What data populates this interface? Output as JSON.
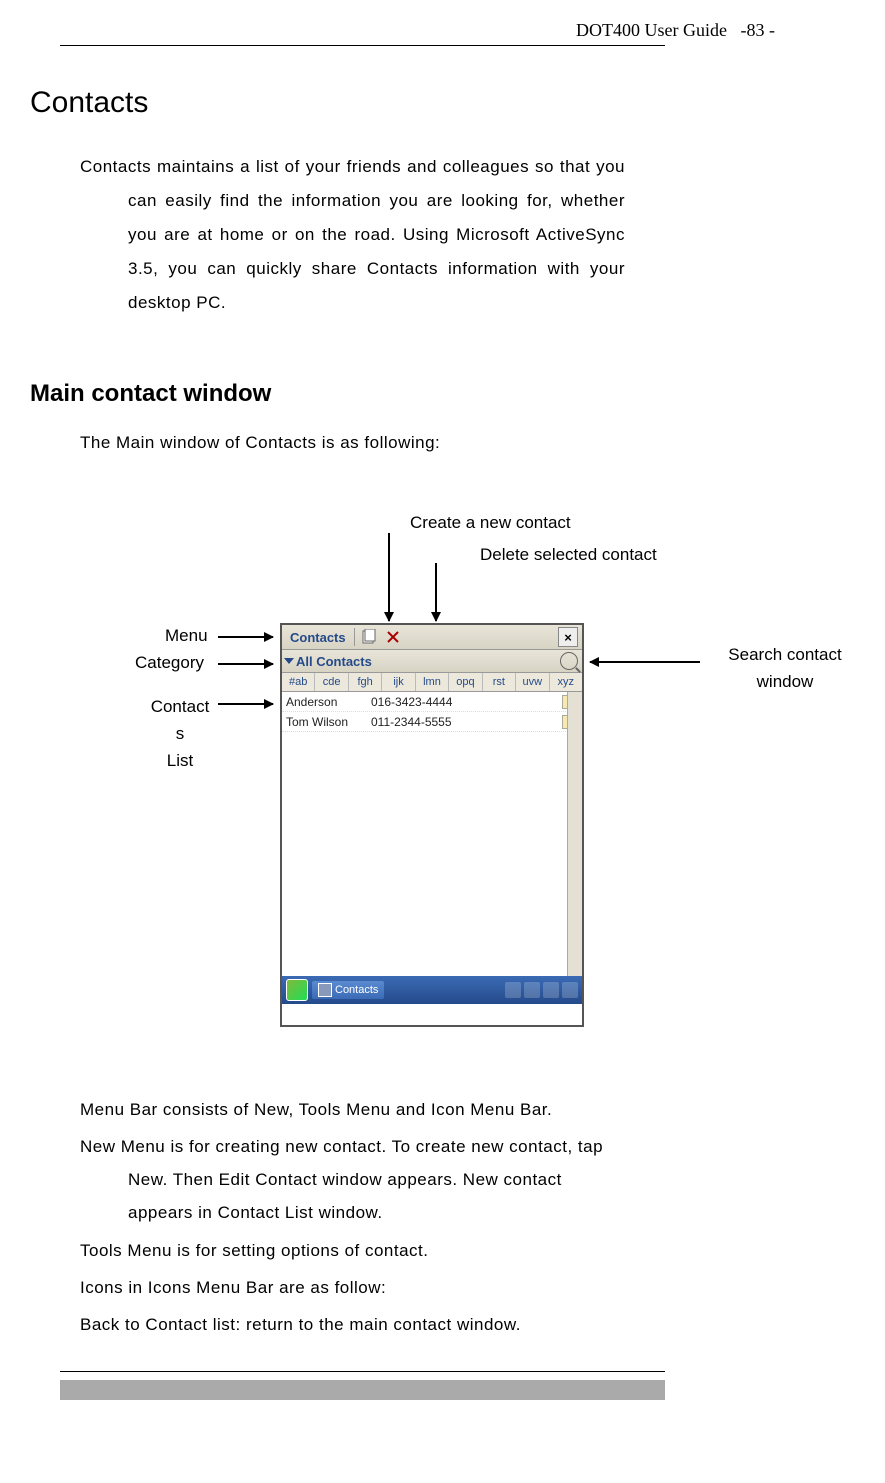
{
  "header": {
    "doc_title": "DOT400 User Guide",
    "page_indicator": "-83 -"
  },
  "title": "Contacts",
  "intro_text": "Contacts maintains a list of your friends and colleagues so that you can easily find the information you are looking for, whether you are at home or on the road. Using Microsoft ActiveSync 3.5, you can quickly share Contacts information with your desktop PC.",
  "subtitle": "Main contact window",
  "lead_text": "The Main window of Contacts is as following:",
  "callouts": {
    "create": "Create a new contact",
    "delete": "Delete selected contact",
    "menu": "Menu",
    "category": "Category",
    "contacts_list_1": "Contact",
    "contacts_list_2": "s",
    "contacts_list_3": "List",
    "search_1": "Search contact",
    "search_2": "window"
  },
  "screenshot": {
    "menu_label": "Contacts",
    "close_label": "×",
    "category_label": "All Contacts",
    "az_tabs": [
      "#ab",
      "cde",
      "fgh",
      "ijk",
      "lmn",
      "opq",
      "rst",
      "uvw",
      "xyz"
    ],
    "rows": [
      {
        "name": "Anderson",
        "phone": "016-3423-4444"
      },
      {
        "name": "Tom Wilson",
        "phone": "011-2344-5555"
      }
    ],
    "task_button": "Contacts"
  },
  "body": {
    "p1": "Menu Bar consists of New, Tools Menu and Icon Menu Bar.",
    "p2": "New Menu is for creating new contact. To create new contact, tap New. Then Edit Contact window appears. New contact appears in Contact List window.",
    "p3": "Tools Menu is for setting options of contact.",
    "p4": "Icons in Icons Menu Bar are as follow:",
    "p5": "Back to Contact list: return to the main contact window."
  }
}
